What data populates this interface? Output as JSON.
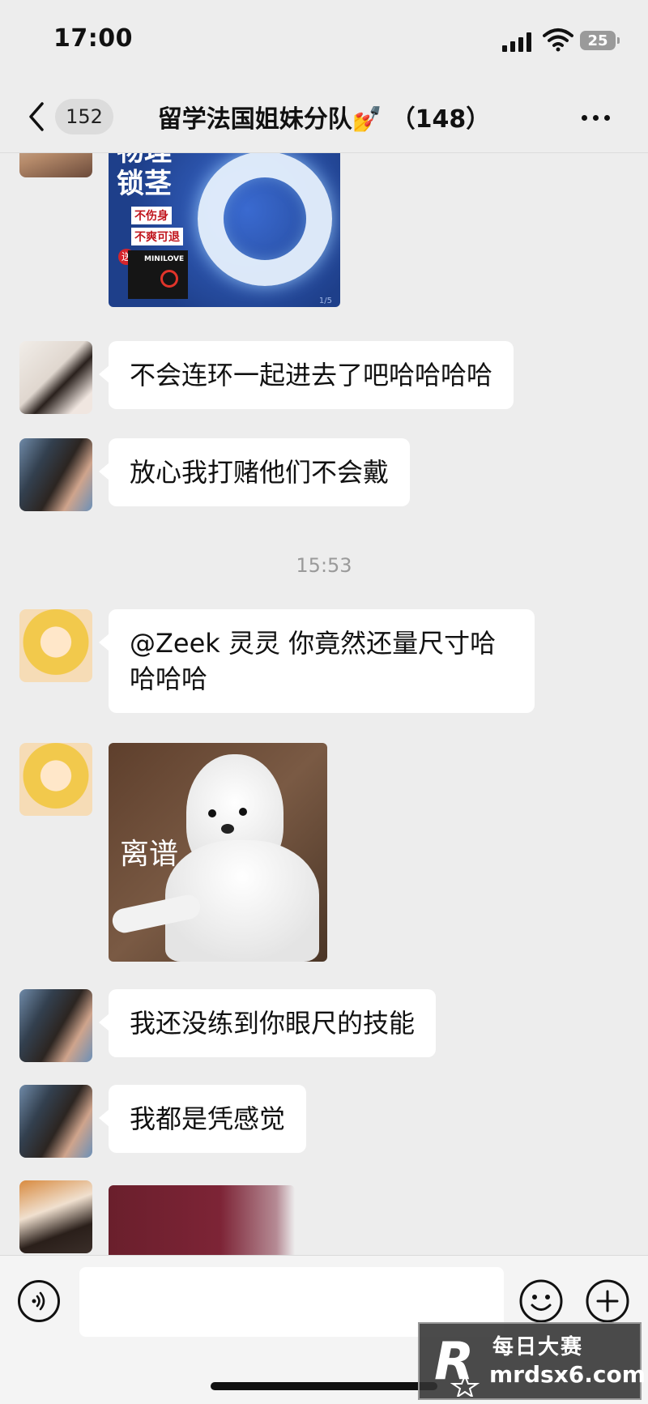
{
  "status_bar": {
    "time": "17:00",
    "battery": "25"
  },
  "header": {
    "unread_count": "152",
    "title": "留学法国姐妹分队💅 （148）"
  },
  "product_image": {
    "headline": "物理锁茎",
    "tags": [
      "不伤身",
      "不爽可退"
    ],
    "brand": "MINILOVE",
    "gift": "送",
    "page_indicator": "1/5"
  },
  "messages": [
    {
      "type": "text",
      "text": "不会连环一起进去了吧哈哈哈哈"
    },
    {
      "type": "text",
      "text": "放心我打赌他们不会戴"
    },
    {
      "type": "time",
      "text": "15:53"
    },
    {
      "type": "text",
      "text": "@Zeek 灵灵  你竟然还量尺寸哈哈哈哈"
    },
    {
      "type": "sticker",
      "caption": "离谱"
    },
    {
      "type": "text",
      "text": "我还没练到你眼尺的技能"
    },
    {
      "type": "text",
      "text": "我都是凭感觉"
    }
  ],
  "input": {
    "placeholder": ""
  },
  "watermark": {
    "title": "每日大赛",
    "url": "mrdsx6.com"
  },
  "icons": {
    "back": "chevron-left-icon",
    "more": "more-dots-icon",
    "voice": "voice-icon",
    "emoji": "emoji-icon",
    "plus": "plus-icon"
  },
  "colors": {
    "background": "#ededed",
    "bubble": "#ffffff",
    "product_bg": "#1e3f8a"
  }
}
